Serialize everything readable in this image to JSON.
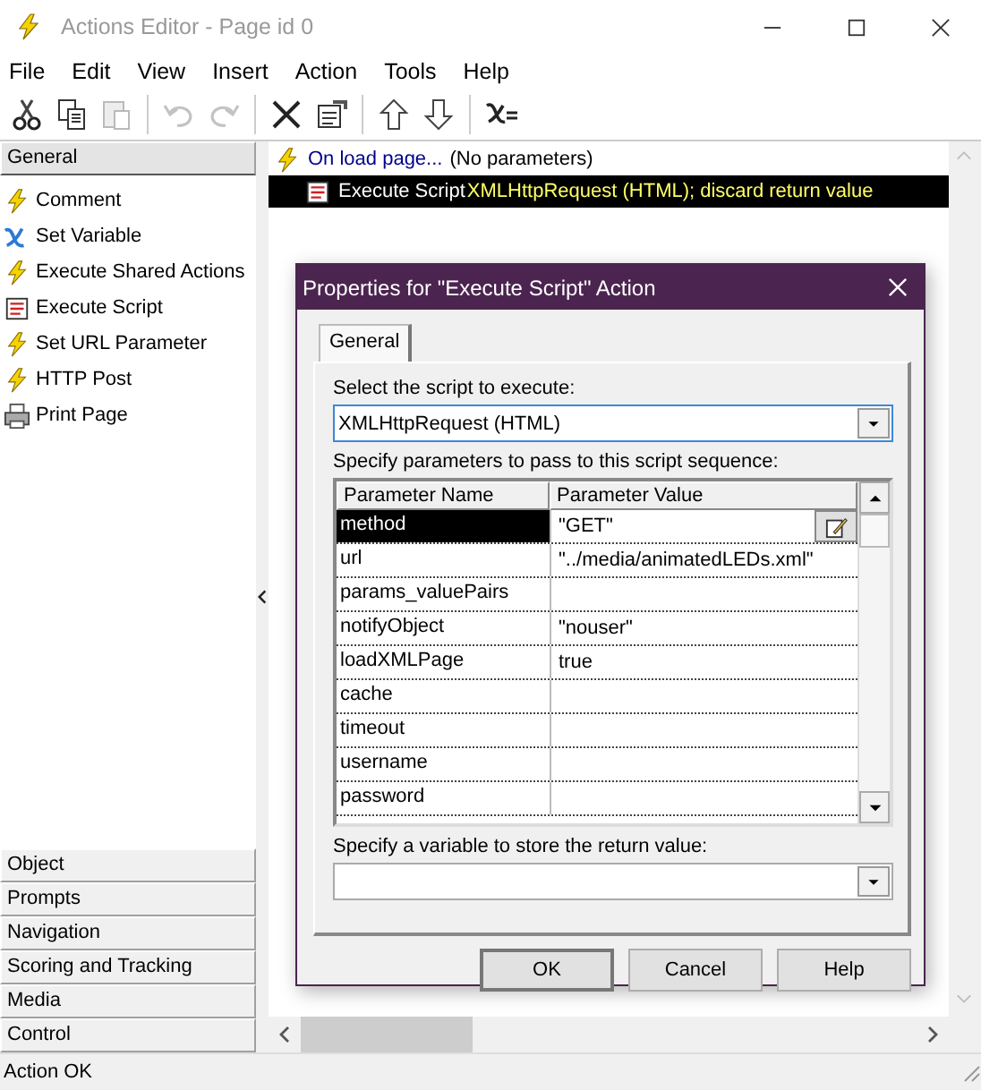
{
  "window": {
    "title": "Actions Editor - Page id 0"
  },
  "menu": [
    "File",
    "Edit",
    "View",
    "Insert",
    "Action",
    "Tools",
    "Help"
  ],
  "toolbar": [
    {
      "kind": "cut",
      "disabled": false
    },
    {
      "kind": "copy",
      "disabled": false
    },
    {
      "kind": "paste",
      "disabled": true
    },
    {
      "kind": "sep"
    },
    {
      "kind": "undo",
      "disabled": true
    },
    {
      "kind": "redo",
      "disabled": true
    },
    {
      "kind": "sep"
    },
    {
      "kind": "delete",
      "disabled": false
    },
    {
      "kind": "properties",
      "disabled": false
    },
    {
      "kind": "sep"
    },
    {
      "kind": "up",
      "disabled": false
    },
    {
      "kind": "down",
      "disabled": false
    },
    {
      "kind": "sep"
    },
    {
      "kind": "variable",
      "disabled": false
    }
  ],
  "sidebar": {
    "categories": [
      {
        "label": "General",
        "expanded": true,
        "items": [
          {
            "label": "Comment",
            "kind": "event"
          },
          {
            "label": "Set Variable",
            "kind": "variable"
          },
          {
            "label": "Execute Shared Actions",
            "kind": "event"
          },
          {
            "label": "Execute Script",
            "kind": "script"
          },
          {
            "label": "Set URL Parameter",
            "kind": "event"
          },
          {
            "label": "HTTP Post",
            "kind": "event"
          },
          {
            "label": "Print Page",
            "kind": "printer"
          }
        ]
      },
      {
        "label": "Object",
        "expanded": false
      },
      {
        "label": "Prompts",
        "expanded": false
      },
      {
        "label": "Navigation",
        "expanded": false
      },
      {
        "label": "Scoring and Tracking",
        "expanded": false
      },
      {
        "label": "Media",
        "expanded": false
      },
      {
        "label": "Control",
        "expanded": false
      }
    ]
  },
  "actions": [
    {
      "kind": "event",
      "label": "On load page...",
      "detail": "(No parameters)",
      "selected": false,
      "children": [
        {
          "kind": "script",
          "label": "Execute Script",
          "detail": "XMLHttpRequest (HTML); discard return value",
          "selected": true
        }
      ]
    }
  ],
  "dialog": {
    "title": "Properties for \"Execute Script\" Action",
    "tabs": [
      {
        "label": "General",
        "selected": true
      }
    ],
    "script_label": "Select the script to execute:",
    "script_value": "XMLHttpRequest (HTML)",
    "params_label": "Specify parameters to pass to this script sequence:",
    "table": {
      "columns": [
        "Parameter Name",
        "Parameter Value"
      ],
      "rows": [
        {
          "name": "method",
          "value": "\"GET\"",
          "selected": true
        },
        {
          "name": "url",
          "value": "\"../media/animatedLEDs.xml\"",
          "selected": false
        },
        {
          "name": "params_valuePairs",
          "selected": false
        },
        {
          "name": "notifyObject",
          "value": "\"nouser\"",
          "selected": false
        },
        {
          "name": "loadXMLPage",
          "value": "true",
          "selected": false
        },
        {
          "name": "cache",
          "selected": false
        },
        {
          "name": "timeout",
          "selected": false
        },
        {
          "name": "username",
          "selected": false
        },
        {
          "name": "password",
          "selected": false
        }
      ]
    },
    "return_label": "Specify a variable to store the return value:",
    "buttons": [
      "OK",
      "Cancel",
      "Help"
    ]
  },
  "status_bar": "Action OK"
}
